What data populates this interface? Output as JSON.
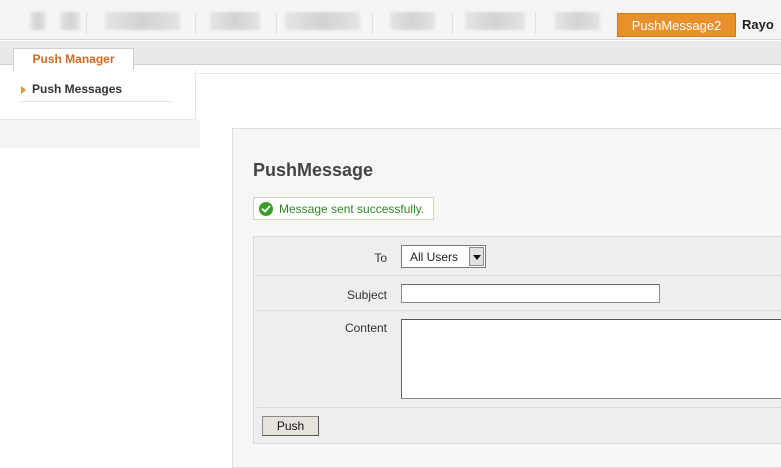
{
  "top_nav": {
    "active_tab": "PushMessage2",
    "next_tab": "Rayo"
  },
  "sub_nav": {
    "tab": "Push Manager"
  },
  "left_menu": {
    "items": [
      {
        "label": "Push Messages",
        "icon": "triangle-right-icon"
      }
    ]
  },
  "main": {
    "title": "PushMessage",
    "success_message": "Message sent successfully.",
    "success_icon": "check-circle-icon",
    "form": {
      "to_label": "To",
      "to_value": "All Users",
      "subject_label": "Subject",
      "subject_value": "",
      "content_label": "Content",
      "content_value": "",
      "push_button": "Push"
    }
  },
  "colors": {
    "accent_orange": "#e8902c",
    "success_green": "#2b8a1f"
  }
}
